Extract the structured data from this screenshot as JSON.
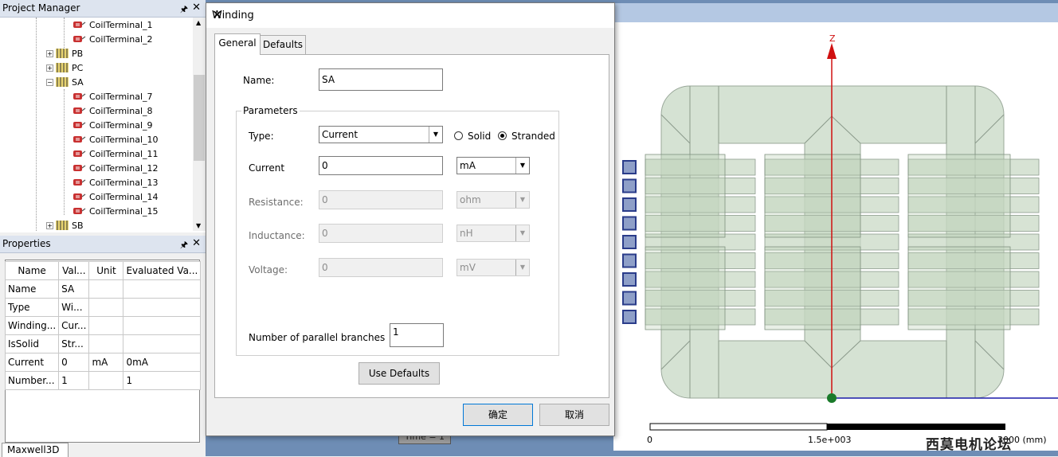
{
  "project_manager": {
    "title": "Project Manager",
    "items": [
      {
        "label": "CoilTerminal_1",
        "kind": "coil"
      },
      {
        "label": "CoilTerminal_2",
        "kind": "coil"
      },
      {
        "label": "PB",
        "kind": "phase",
        "expander": "+"
      },
      {
        "label": "PC",
        "kind": "phase",
        "expander": "+"
      },
      {
        "label": "SA",
        "kind": "phase",
        "expander": "−"
      },
      {
        "label": "CoilTerminal_7",
        "kind": "coil"
      },
      {
        "label": "CoilTerminal_8",
        "kind": "coil"
      },
      {
        "label": "CoilTerminal_9",
        "kind": "coil"
      },
      {
        "label": "CoilTerminal_10",
        "kind": "coil"
      },
      {
        "label": "CoilTerminal_11",
        "kind": "coil"
      },
      {
        "label": "CoilTerminal_12",
        "kind": "coil"
      },
      {
        "label": "CoilTerminal_13",
        "kind": "coil"
      },
      {
        "label": "CoilTerminal_14",
        "kind": "coil"
      },
      {
        "label": "CoilTerminal_15",
        "kind": "coil"
      },
      {
        "label": "SB",
        "kind": "phase",
        "expander": "+"
      }
    ]
  },
  "properties": {
    "title": "Properties",
    "headers": [
      "Name",
      "Val...",
      "Unit",
      "Evaluated Va..."
    ],
    "rows": [
      [
        "Name",
        "SA",
        "",
        ""
      ],
      [
        "Type",
        "Wi...",
        "",
        ""
      ],
      [
        "Winding...",
        "Cur...",
        "",
        ""
      ],
      [
        "IsSolid",
        "Str...",
        "",
        ""
      ],
      [
        "Current",
        "0",
        "mA",
        "0mA"
      ],
      [
        "Number...",
        "1",
        "",
        "1"
      ]
    ],
    "tab": "Maxwell3D"
  },
  "dialog": {
    "title": "Winding",
    "tabs": [
      "General",
      "Defaults"
    ],
    "name_label": "Name:",
    "name_value": "SA",
    "group_label": "Parameters",
    "type_label": "Type:",
    "type_value": "Current",
    "solid_label": "Solid",
    "stranded_label": "Stranded",
    "current_label": "Current",
    "current_value": "0",
    "current_unit": "mA",
    "resistance_label": "Resistance:",
    "resistance_value": "0",
    "resistance_unit": "ohm",
    "inductance_label": "Inductance:",
    "inductance_value": "0",
    "inductance_unit": "nH",
    "voltage_label": "Voltage:",
    "voltage_value": "0",
    "voltage_unit": "mV",
    "branches_label": "Number of parallel branches",
    "branches_value": "1",
    "use_defaults": "Use Defaults",
    "ok": "确定",
    "cancel": "取消"
  },
  "view": {
    "axis_z": "Z",
    "scale_0": "0",
    "scale_mid": "1.5e+003",
    "scale_end": "3000 (mm)",
    "time_label": "Time = 1",
    "watermark": "西莫电机论坛"
  },
  "colors": {
    "panel_title": "#dde4ef",
    "view_frame": "#6e8db5",
    "core": "#d8e4d6",
    "axis_red": "#d01010",
    "axis_blue": "#1a1aa8"
  }
}
